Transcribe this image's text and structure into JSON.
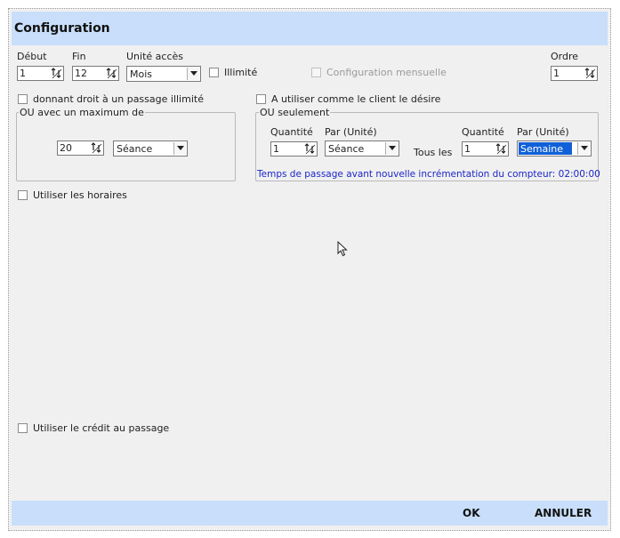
{
  "dialog": {
    "title": "Configuration"
  },
  "fields": {
    "debut": {
      "label": "Début",
      "value": "1"
    },
    "fin": {
      "label": "Fin",
      "value": "12"
    },
    "unite_acces": {
      "label": "Unité accès",
      "value": "Mois"
    },
    "illimite": {
      "label": "Illimité",
      "checked": false
    },
    "config_mensuelle": {
      "label": "Configuration mensuelle",
      "checked": false,
      "disabled": true
    },
    "ordre": {
      "label": "Ordre",
      "value": "1"
    }
  },
  "left": {
    "checkbox_label": "donnant droit à un passage illimité",
    "group_legend": "OU avec un maximum de",
    "max_value": "20",
    "max_unit": "Séance"
  },
  "right": {
    "checkbox_label": "A utiliser comme le client le désire",
    "group_legend": "OU seulement",
    "qty_label_1": "Quantité",
    "par_label_1": "Par (Unité)",
    "qty_value_1": "1",
    "par_value_1": "Séance",
    "tous_les": "Tous les",
    "qty_label_2": "Quantité",
    "par_label_2": "Par (Unité)",
    "qty_value_2": "1",
    "par_value_2": "Semaine",
    "info_text": "Temps de passage avant nouvelle incrémentation du compteur: 02:00:00"
  },
  "options": {
    "horaires": "Utiliser les horaires",
    "credit": "Utiliser le crédit au passage"
  },
  "footer": {
    "ok": "OK",
    "cancel": "ANNULER"
  },
  "colors": {
    "header_band": "#c8defa",
    "selection": "#1060d8",
    "info_text": "#1b26c9"
  }
}
